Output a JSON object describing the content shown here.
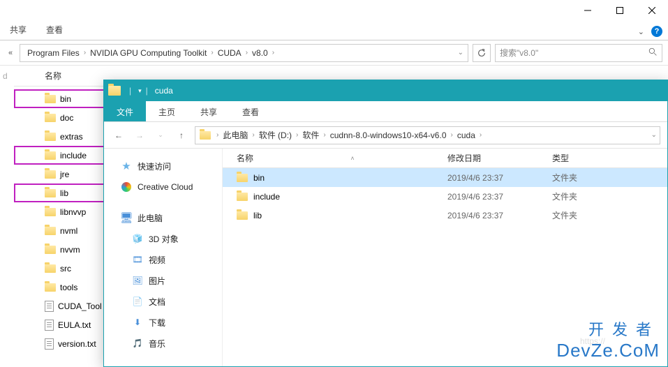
{
  "back": {
    "ribbon": {
      "share": "共享",
      "view": "查看"
    },
    "breadcrumb": [
      "Program Files",
      "NVIDIA GPU Computing Toolkit",
      "CUDA",
      "v8.0"
    ],
    "search_placeholder": "搜索\"v8.0\"",
    "column_header": "名称",
    "left_label": "d",
    "tree": [
      {
        "name": "bin",
        "type": "folder",
        "hl": true
      },
      {
        "name": "doc",
        "type": "folder",
        "hl": false
      },
      {
        "name": "extras",
        "type": "folder",
        "hl": false
      },
      {
        "name": "include",
        "type": "folder",
        "hl": true
      },
      {
        "name": "jre",
        "type": "folder",
        "hl": false
      },
      {
        "name": "lib",
        "type": "folder",
        "hl": true
      },
      {
        "name": "libnvvp",
        "type": "folder",
        "hl": false
      },
      {
        "name": "nvml",
        "type": "folder",
        "hl": false
      },
      {
        "name": "nvvm",
        "type": "folder",
        "hl": false
      },
      {
        "name": "src",
        "type": "folder",
        "hl": false
      },
      {
        "name": "tools",
        "type": "folder",
        "hl": false
      },
      {
        "name": "CUDA_Tool",
        "type": "file",
        "hl": false
      },
      {
        "name": "EULA.txt",
        "type": "file",
        "hl": false
      },
      {
        "name": "version.txt",
        "type": "file",
        "hl": false
      }
    ]
  },
  "front": {
    "title": "cuda",
    "ribbon": {
      "file": "文件",
      "home": "主页",
      "share": "共享",
      "view": "查看"
    },
    "breadcrumb": [
      "此电脑",
      "软件 (D:)",
      "软件",
      "cudnn-8.0-windows10-x64-v6.0",
      "cuda"
    ],
    "nav": {
      "quick": "快速访问",
      "cc": "Creative Cloud",
      "pc": "此电脑",
      "pc_items": [
        "3D 对象",
        "视频",
        "图片",
        "文档",
        "下载",
        "音乐"
      ]
    },
    "columns": {
      "name": "名称",
      "date": "修改日期",
      "type": "类型"
    },
    "rows": [
      {
        "name": "bin",
        "date": "2019/4/6 23:37",
        "type": "文件夹",
        "selected": true
      },
      {
        "name": "include",
        "date": "2019/4/6 23:37",
        "type": "文件夹",
        "selected": false
      },
      {
        "name": "lib",
        "date": "2019/4/6 23:37",
        "type": "文件夹",
        "selected": false
      }
    ]
  },
  "watermark": {
    "line1": "开发者",
    "line2": "DevZe.CoM",
    "ghost": "https://"
  }
}
